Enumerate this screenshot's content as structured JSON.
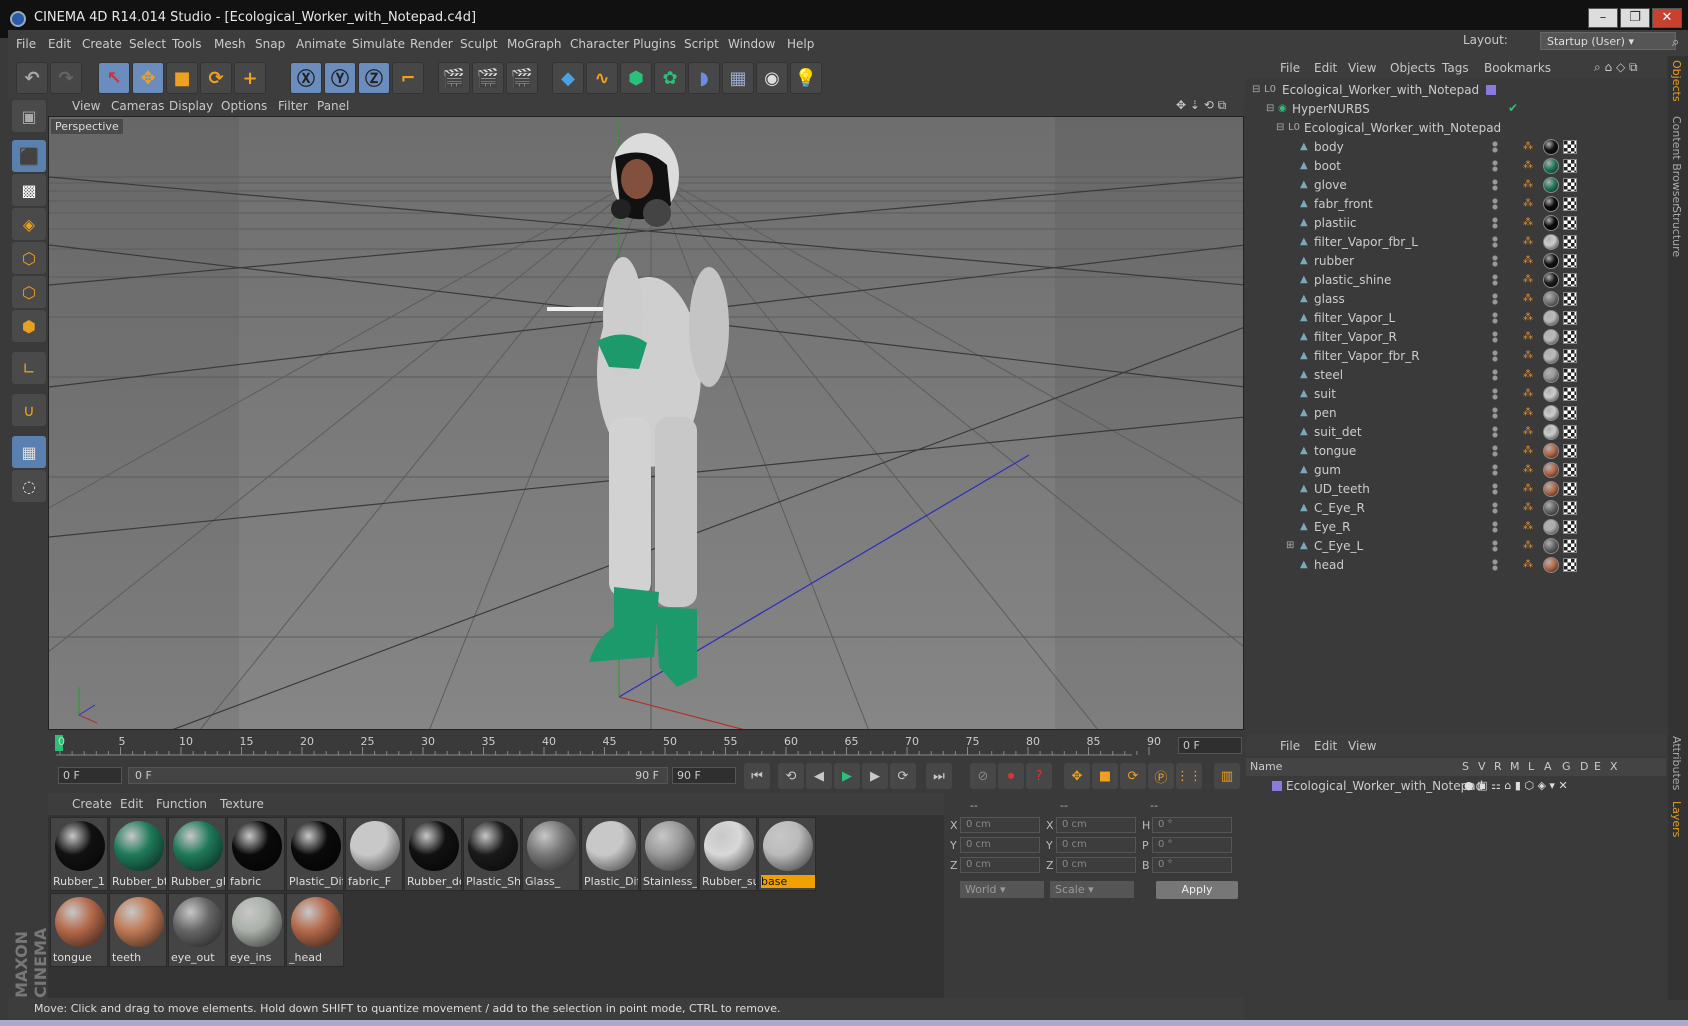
{
  "window": {
    "title": "CINEMA 4D R14.014 Studio - [Ecological_Worker_with_Notepad.c4d]"
  },
  "menu": {
    "items": [
      "File",
      "Edit",
      "Create",
      "Select",
      "Tools",
      "Mesh",
      "Snap",
      "Animate",
      "Simulate",
      "Render",
      "Sculpt",
      "MoGraph",
      "Character",
      "Plugins",
      "Script",
      "Window",
      "Help"
    ],
    "layout_label": "Layout:",
    "layout_value": "Startup (User)"
  },
  "viewport": {
    "menu": [
      "View",
      "Cameras",
      "Display",
      "Options",
      "Filter",
      "Panel"
    ],
    "label": "Perspective"
  },
  "timeline": {
    "ticks": [
      "0",
      "5",
      "10",
      "15",
      "20",
      "25",
      "30",
      "35",
      "40",
      "45",
      "50",
      "55",
      "60",
      "65",
      "70",
      "75",
      "80",
      "85",
      "90"
    ],
    "current_frame": "0 F",
    "start_field": "0 F",
    "range_start": "0 F",
    "range_end": "90 F",
    "end_field": "90 F"
  },
  "materials": {
    "menu": [
      "Create",
      "Edit",
      "Function",
      "Texture"
    ],
    "items": [
      {
        "name": "Rubber_1",
        "color": "#111111"
      },
      {
        "name": "Rubber_bt",
        "color": "#1f7a5a"
      },
      {
        "name": "Rubber_gl",
        "color": "#1f7a5a"
      },
      {
        "name": "fabric",
        "color": "#0a0a0a"
      },
      {
        "name": "Plastic_Diff",
        "color": "#0a0a0a"
      },
      {
        "name": "fabric_F",
        "color": "#c8c8c8"
      },
      {
        "name": "Rubber_de",
        "color": "#111111"
      },
      {
        "name": "Plastic_Shir",
        "color": "#1a1a1a"
      },
      {
        "name": "Glass_",
        "color": "#777777"
      },
      {
        "name": "Plastic_Diff",
        "color": "#c8c8c8"
      },
      {
        "name": "Stainless_S",
        "color": "#999999"
      },
      {
        "name": "Rubber_su",
        "color": "#d8d8d8"
      },
      {
        "name": "base",
        "color": "#bbbbbb"
      },
      {
        "name": "tongue",
        "color": "#b5694a"
      },
      {
        "name": "teeth",
        "color": "#c07a55"
      },
      {
        "name": "eye_out",
        "color": "#666666"
      },
      {
        "name": "eye_ins",
        "color": "#aab0aa"
      },
      {
        "name": "_head",
        "color": "#b5694a"
      }
    ]
  },
  "coords": {
    "headers": [
      "--",
      "--",
      "--"
    ],
    "rows": [
      {
        "a": "X",
        "av": "0 cm",
        "b": "X",
        "bv": "0 cm",
        "c": "H",
        "cv": "0 °"
      },
      {
        "a": "Y",
        "av": "0 cm",
        "b": "Y",
        "bv": "0 cm",
        "c": "P",
        "cv": "0 °"
      },
      {
        "a": "Z",
        "av": "0 cm",
        "b": "Z",
        "bv": "0 cm",
        "c": "B",
        "cv": "0 °"
      }
    ],
    "space": "World",
    "mode": "Scale",
    "apply": "Apply"
  },
  "objects": {
    "menu": [
      "File",
      "Edit",
      "View",
      "Objects",
      "Tags",
      "Bookmarks"
    ],
    "root": "Ecological_Worker_with_Notepad",
    "hypernurbs": "HyperNURBS",
    "group": "Ecological_Worker_with_Notepad",
    "children": [
      {
        "name": "body",
        "tag": "#111111"
      },
      {
        "name": "boot",
        "tag": "#1f7a5a"
      },
      {
        "name": "glove",
        "tag": "#1f7a5a"
      },
      {
        "name": "fabr_front",
        "tag": "#0a0a0a"
      },
      {
        "name": "plastiic",
        "tag": "#0a0a0a"
      },
      {
        "name": "filter_Vapor_fbr_L",
        "tag": "#cccccc"
      },
      {
        "name": "rubber",
        "tag": "#111111"
      },
      {
        "name": "plastic_shine",
        "tag": "#1a1a1a"
      },
      {
        "name": "glass",
        "tag": "#777777"
      },
      {
        "name": "filter_Vapor_L",
        "tag": "#bbbbbb"
      },
      {
        "name": "filter_Vapor_R",
        "tag": "#bbbbbb"
      },
      {
        "name": "filter_Vapor_fbr_R",
        "tag": "#bbbbbb"
      },
      {
        "name": "steel",
        "tag": "#999999"
      },
      {
        "name": "suit",
        "tag": "#cccccc"
      },
      {
        "name": "pen",
        "tag": "#cccccc"
      },
      {
        "name": "suit_det",
        "tag": "#cccccc"
      },
      {
        "name": "tongue",
        "tag": "#b5694a"
      },
      {
        "name": "gum",
        "tag": "#b5694a"
      },
      {
        "name": "UD_teeth",
        "tag": "#b5694a"
      },
      {
        "name": "C_Eye_R",
        "tag": "#666666"
      },
      {
        "name": "Eye_R",
        "tag": "#aab0aa"
      },
      {
        "name": "C_Eye_L",
        "tag": "#666666"
      },
      {
        "name": "head",
        "tag": "#b5694a"
      }
    ]
  },
  "layers": {
    "menu": [
      "File",
      "Edit",
      "View"
    ],
    "headers": [
      "Name",
      "S",
      "V",
      "R",
      "M",
      "L",
      "A",
      "G",
      "D",
      "E",
      "X"
    ],
    "row": "Ecological_Worker_with_Notepad"
  },
  "sidetabs": [
    "Objects",
    "Content Browser",
    "Structure",
    "Attributes",
    "Layers"
  ],
  "status": "Move: Click and drag to move elements. Hold down SHIFT to quantize movement / add to the selection in point mode, CTRL to remove.",
  "brand": "MAXON CINEMA 4D"
}
